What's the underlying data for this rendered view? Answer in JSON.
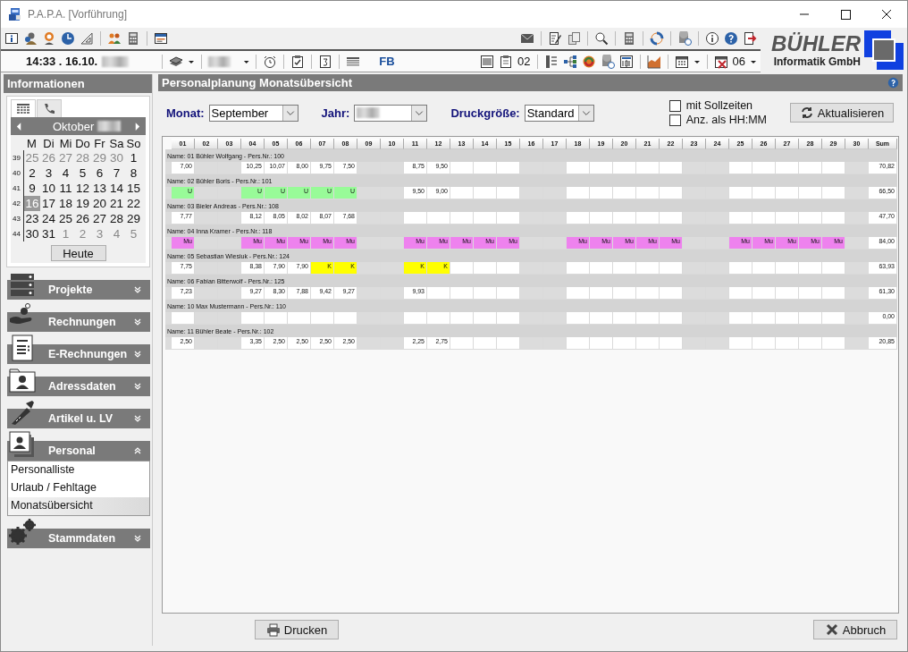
{
  "window": {
    "title": "P.A.P.A. [Vorführung]"
  },
  "toolbar": {
    "clock": "14:33 . 16.10.",
    "user_code": "FB",
    "clipboard_count": "02",
    "calendar_value": "06"
  },
  "logo": {
    "name": "BÜHLER",
    "subtitle": "Informatik GmbH"
  },
  "sidebar": {
    "title": "Informationen",
    "tabs": [
      {
        "kind": "calendar",
        "selected": true
      },
      {
        "kind": "phone",
        "selected": false
      }
    ],
    "calendar": {
      "month": "Oktober",
      "weekdays": [
        "M",
        "Di",
        "Mi",
        "Do",
        "Fr",
        "Sa",
        "So"
      ],
      "weeks": [
        {
          "number": "39",
          "days": [
            {
              "day": "25",
              "other_month": true,
              "selected": false
            },
            {
              "day": "26",
              "other_month": true,
              "selected": false
            },
            {
              "day": "27",
              "other_month": true,
              "selected": false
            },
            {
              "day": "28",
              "other_month": true,
              "selected": false
            },
            {
              "day": "29",
              "other_month": true,
              "selected": false
            },
            {
              "day": "30",
              "other_month": true,
              "selected": false
            },
            {
              "day": "1",
              "other_month": false,
              "selected": false
            }
          ]
        },
        {
          "number": "40",
          "days": [
            {
              "day": "2",
              "other_month": false,
              "selected": false
            },
            {
              "day": "3",
              "other_month": false,
              "selected": false
            },
            {
              "day": "4",
              "other_month": false,
              "selected": false
            },
            {
              "day": "5",
              "other_month": false,
              "selected": false
            },
            {
              "day": "6",
              "other_month": false,
              "selected": false
            },
            {
              "day": "7",
              "other_month": false,
              "selected": false
            },
            {
              "day": "8",
              "other_month": false,
              "selected": false
            }
          ]
        },
        {
          "number": "41",
          "days": [
            {
              "day": "9",
              "other_month": false,
              "selected": false
            },
            {
              "day": "10",
              "other_month": false,
              "selected": false
            },
            {
              "day": "11",
              "other_month": false,
              "selected": false
            },
            {
              "day": "12",
              "other_month": false,
              "selected": false
            },
            {
              "day": "13",
              "other_month": false,
              "selected": false
            },
            {
              "day": "14",
              "other_month": false,
              "selected": false
            },
            {
              "day": "15",
              "other_month": false,
              "selected": false
            }
          ]
        },
        {
          "number": "42",
          "days": [
            {
              "day": "16",
              "other_month": false,
              "selected": true
            },
            {
              "day": "17",
              "other_month": false,
              "selected": false
            },
            {
              "day": "18",
              "other_month": false,
              "selected": false
            },
            {
              "day": "19",
              "other_month": false,
              "selected": false
            },
            {
              "day": "20",
              "other_month": false,
              "selected": false
            },
            {
              "day": "21",
              "other_month": false,
              "selected": false
            },
            {
              "day": "22",
              "other_month": false,
              "selected": false
            }
          ]
        },
        {
          "number": "43",
          "days": [
            {
              "day": "23",
              "other_month": false,
              "selected": false
            },
            {
              "day": "24",
              "other_month": false,
              "selected": false
            },
            {
              "day": "25",
              "other_month": false,
              "selected": false
            },
            {
              "day": "26",
              "other_month": false,
              "selected": false
            },
            {
              "day": "27",
              "other_month": false,
              "selected": false
            },
            {
              "day": "28",
              "other_month": false,
              "selected": false
            },
            {
              "day": "29",
              "other_month": false,
              "selected": false
            }
          ]
        },
        {
          "number": "44",
          "days": [
            {
              "day": "30",
              "other_month": false,
              "selected": false
            },
            {
              "day": "31",
              "other_month": false,
              "selected": false
            },
            {
              "day": "1",
              "other_month": true,
              "selected": false
            },
            {
              "day": "2",
              "other_month": true,
              "selected": false
            },
            {
              "day": "3",
              "other_month": true,
              "selected": false
            },
            {
              "day": "4",
              "other_month": true,
              "selected": false
            },
            {
              "day": "5",
              "other_month": true,
              "selected": false
            }
          ]
        }
      ],
      "today_button": "Heute"
    },
    "groups": [
      {
        "label": "Projekte",
        "kind": "server",
        "expanded": false
      },
      {
        "label": "Rechnungen",
        "kind": "hand",
        "expanded": false
      },
      {
        "label": "E-Rechnungen",
        "kind": "document",
        "expanded": false
      },
      {
        "label": "Adressdaten",
        "kind": "contact",
        "expanded": false
      },
      {
        "label": "Artikel u. LV",
        "kind": "screw",
        "expanded": false
      },
      {
        "label": "Personal",
        "kind": "photos",
        "expanded": true,
        "items": [
          {
            "label": "Personalliste",
            "selected": false
          },
          {
            "label": "Urlaub / Fehltage",
            "selected": false
          },
          {
            "label": "Monatsübersicht",
            "selected": true
          }
        ]
      },
      {
        "label": "Stammdaten",
        "kind": "gears",
        "expanded": false
      }
    ]
  },
  "main": {
    "title": "Personalplanung Monatsübersicht",
    "month_label": "Monat:",
    "month": "September",
    "year_label": "Jahr:",
    "print_size_label": "Druckgröße:",
    "print_size": "Standard",
    "options": [
      {
        "label": "mit Sollzeiten",
        "checked": false
      },
      {
        "label": "Anz. als HH:MM",
        "checked": false
      }
    ],
    "refresh_button": "Aktualisieren"
  },
  "grid": {
    "columns": [
      {
        "label": "01",
        "weekend": false
      },
      {
        "label": "02",
        "weekend": true
      },
      {
        "label": "03",
        "weekend": true
      },
      {
        "label": "04",
        "weekend": false
      },
      {
        "label": "05",
        "weekend": false
      },
      {
        "label": "06",
        "weekend": false
      },
      {
        "label": "07",
        "weekend": false
      },
      {
        "label": "08",
        "weekend": false
      },
      {
        "label": "09",
        "weekend": true
      },
      {
        "label": "10",
        "weekend": true
      },
      {
        "label": "11",
        "weekend": false
      },
      {
        "label": "12",
        "weekend": false
      },
      {
        "label": "13",
        "weekend": false
      },
      {
        "label": "14",
        "weekend": false
      },
      {
        "label": "15",
        "weekend": false
      },
      {
        "label": "16",
        "weekend": true
      },
      {
        "label": "17",
        "weekend": true
      },
      {
        "label": "18",
        "weekend": false
      },
      {
        "label": "19",
        "weekend": false
      },
      {
        "label": "20",
        "weekend": false
      },
      {
        "label": "21",
        "weekend": false
      },
      {
        "label": "22",
        "weekend": false
      },
      {
        "label": "23",
        "weekend": true
      },
      {
        "label": "24",
        "weekend": true
      },
      {
        "label": "25",
        "weekend": false
      },
      {
        "label": "26",
        "weekend": false
      },
      {
        "label": "27",
        "weekend": false
      },
      {
        "label": "28",
        "weekend": false
      },
      {
        "label": "29",
        "weekend": false
      },
      {
        "label": "30",
        "weekend": true
      }
    ],
    "sum_label": "Sum",
    "rows": [
      {
        "name": "Name: 01 Bühler Wolfgang - Pers.Nr.: 100",
        "sum": "70,82",
        "cells": [
          {
            "text": "7,00",
            "kind": "hours"
          },
          null,
          null,
          {
            "text": "10,25",
            "kind": "hours"
          },
          {
            "text": "10,07",
            "kind": "hours"
          },
          {
            "text": "8,00",
            "kind": "hours"
          },
          {
            "text": "9,75",
            "kind": "hours"
          },
          {
            "text": "7,50",
            "kind": "hours"
          },
          null,
          null,
          {
            "text": "8,75",
            "kind": "hours"
          },
          {
            "text": "9,50",
            "kind": "hours"
          },
          null,
          null,
          null,
          null,
          null,
          null,
          null,
          null,
          null,
          null,
          null,
          null,
          null,
          null,
          null,
          null,
          null,
          null
        ]
      },
      {
        "name": "Name: 02 Bühler Boris - Pers.Nr.: 101",
        "sum": "66,50",
        "cells": [
          {
            "text": "U",
            "kind": "vacation"
          },
          null,
          null,
          {
            "text": "U",
            "kind": "vacation"
          },
          {
            "text": "U",
            "kind": "vacation"
          },
          {
            "text": "U",
            "kind": "vacation"
          },
          {
            "text": "U",
            "kind": "vacation"
          },
          {
            "text": "U",
            "kind": "vacation"
          },
          null,
          null,
          {
            "text": "9,50",
            "kind": "hours"
          },
          {
            "text": "9,00",
            "kind": "hours"
          },
          null,
          null,
          null,
          null,
          null,
          null,
          null,
          null,
          null,
          null,
          null,
          null,
          null,
          null,
          null,
          null,
          null,
          null
        ]
      },
      {
        "name": "Name: 03 Bieler Andreas - Pers.Nr.: 108",
        "sum": "47,70",
        "cells": [
          {
            "text": "7,77",
            "kind": "hours"
          },
          null,
          null,
          {
            "text": "8,12",
            "kind": "hours"
          },
          {
            "text": "8,05",
            "kind": "hours"
          },
          {
            "text": "8,02",
            "kind": "hours"
          },
          {
            "text": "8,07",
            "kind": "hours"
          },
          {
            "text": "7,68",
            "kind": "hours"
          },
          null,
          null,
          null,
          null,
          null,
          null,
          null,
          null,
          null,
          null,
          null,
          null,
          null,
          null,
          null,
          null,
          null,
          null,
          null,
          null,
          null,
          null
        ]
      },
      {
        "name": "Name: 04 Inna Kramer - Pers.Nr.: 118",
        "sum": "84,00",
        "cells": [
          {
            "text": "Mu",
            "kind": "maternity"
          },
          null,
          null,
          {
            "text": "Mu",
            "kind": "maternity"
          },
          {
            "text": "Mu",
            "kind": "maternity"
          },
          {
            "text": "Mu",
            "kind": "maternity"
          },
          {
            "text": "Mu",
            "kind": "maternity"
          },
          {
            "text": "Mu",
            "kind": "maternity"
          },
          null,
          null,
          {
            "text": "Mu",
            "kind": "maternity"
          },
          {
            "text": "Mu",
            "kind": "maternity"
          },
          {
            "text": "Mu",
            "kind": "maternity"
          },
          {
            "text": "Mu",
            "kind": "maternity"
          },
          {
            "text": "Mu",
            "kind": "maternity"
          },
          null,
          null,
          {
            "text": "Mu",
            "kind": "maternity"
          },
          {
            "text": "Mu",
            "kind": "maternity"
          },
          {
            "text": "Mu",
            "kind": "maternity"
          },
          {
            "text": "Mu",
            "kind": "maternity"
          },
          {
            "text": "Mu",
            "kind": "maternity"
          },
          null,
          null,
          {
            "text": "Mu",
            "kind": "maternity"
          },
          {
            "text": "Mu",
            "kind": "maternity"
          },
          {
            "text": "Mu",
            "kind": "maternity"
          },
          {
            "text": "Mu",
            "kind": "maternity"
          },
          {
            "text": "Mu",
            "kind": "maternity"
          },
          null
        ]
      },
      {
        "name": "Name: 05 Sebastian Wiesiuk - Pers.Nr.: 124",
        "sum": "63,93",
        "cells": [
          {
            "text": "7,75",
            "kind": "hours"
          },
          null,
          null,
          {
            "text": "8,38",
            "kind": "hours"
          },
          {
            "text": "7,90",
            "kind": "hours"
          },
          {
            "text": "7,90",
            "kind": "hours"
          },
          {
            "text": "K",
            "kind": "sick"
          },
          {
            "text": "K",
            "kind": "sick"
          },
          null,
          null,
          {
            "text": "K",
            "kind": "sick"
          },
          {
            "text": "K",
            "kind": "sick"
          },
          null,
          null,
          null,
          null,
          null,
          null,
          null,
          null,
          null,
          null,
          null,
          null,
          null,
          null,
          null,
          null,
          null,
          null
        ]
      },
      {
        "name": "Name: 06 Fabian Bitterwolf - Pers.Nr.: 125",
        "sum": "61,30",
        "cells": [
          {
            "text": "7,23",
            "kind": "hours"
          },
          null,
          null,
          {
            "text": "9,27",
            "kind": "hours"
          },
          {
            "text": "8,30",
            "kind": "hours"
          },
          {
            "text": "7,88",
            "kind": "hours"
          },
          {
            "text": "9,42",
            "kind": "hours"
          },
          {
            "text": "9,27",
            "kind": "hours"
          },
          null,
          null,
          {
            "text": "9,93",
            "kind": "hours"
          },
          null,
          null,
          null,
          null,
          null,
          null,
          null,
          null,
          null,
          null,
          null,
          null,
          null,
          null,
          null,
          null,
          null,
          null,
          null
        ]
      },
      {
        "name": "Name: 10 Max Mustermann - Pers.Nr.: 110",
        "sum": "0,00",
        "cells": [
          null,
          null,
          null,
          null,
          null,
          null,
          null,
          null,
          null,
          null,
          null,
          null,
          null,
          null,
          null,
          null,
          null,
          null,
          null,
          null,
          null,
          null,
          null,
          null,
          null,
          null,
          null,
          null,
          null,
          null
        ]
      },
      {
        "name": "Name: 11 Bühler Beate - Pers.Nr.: 102",
        "sum": "20,85",
        "cells": [
          {
            "text": "2,50",
            "kind": "hours"
          },
          null,
          null,
          {
            "text": "3,35",
            "kind": "hours"
          },
          {
            "text": "2,50",
            "kind": "hours"
          },
          {
            "text": "2,50",
            "kind": "hours"
          },
          {
            "text": "2,50",
            "kind": "hours"
          },
          {
            "text": "2,50",
            "kind": "hours"
          },
          null,
          null,
          {
            "text": "2,25",
            "kind": "hours"
          },
          {
            "text": "2,75",
            "kind": "hours"
          },
          null,
          null,
          null,
          null,
          null,
          null,
          null,
          null,
          null,
          null,
          null,
          null,
          null,
          null,
          null,
          null,
          null,
          null
        ]
      }
    ]
  },
  "footer": {
    "print_button": "Drucken",
    "cancel_button": "Abbruch"
  }
}
